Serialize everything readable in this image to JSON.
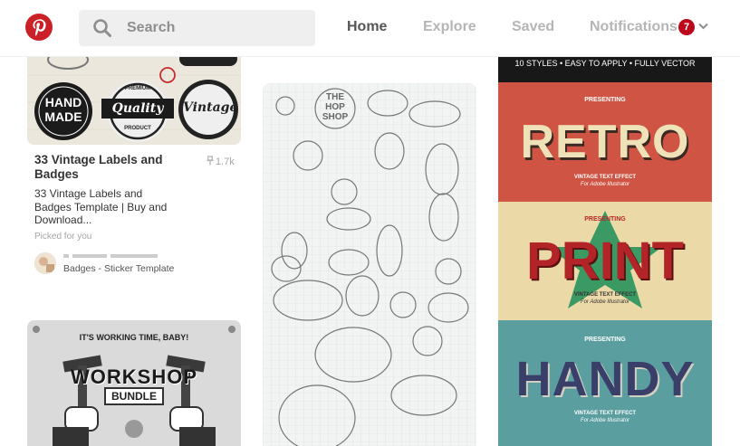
{
  "header": {
    "search_placeholder": "Search",
    "nav": {
      "home": "Home",
      "explore": "Explore",
      "saved": "Saved",
      "notifications": "Notifications"
    },
    "notification_count": "7",
    "brand_color": "#bd081c"
  },
  "pins": {
    "labels_pin": {
      "title": "33 Vintage Labels and Badges",
      "saves": "1.7k",
      "description": "33 Vintage Labels and Badges Template | Buy and Download...",
      "picked": "Picked for you",
      "board": "Badges - Sticker Template",
      "image_text": {
        "hand": "HAND",
        "made": "MADE",
        "quality": "Quality",
        "vintage": "Vintage",
        "premium": "PREMIUM",
        "product": "PRODUCT"
      }
    },
    "sketch_pin": {
      "image_text": {
        "the": "THE",
        "hop": "HOP",
        "shop": "SHOP"
      }
    },
    "retro_pin": {
      "image_text": {
        "top": "10 STYLES • EASY TO APPLY • FULLY VECTOR",
        "presenting": "PRESENTING",
        "retro": "RETRO",
        "print": "PRINT",
        "handy": "HANDY",
        "effect": "VINTAGE TEXT EFFECT",
        "for": "For Adobe Illustrator"
      }
    },
    "workshop_pin": {
      "image_text": {
        "tagline": "IT'S WORKING TIME, BABY!",
        "workshop": "WORKSHOP",
        "bundle": "BUNDLE"
      }
    }
  }
}
